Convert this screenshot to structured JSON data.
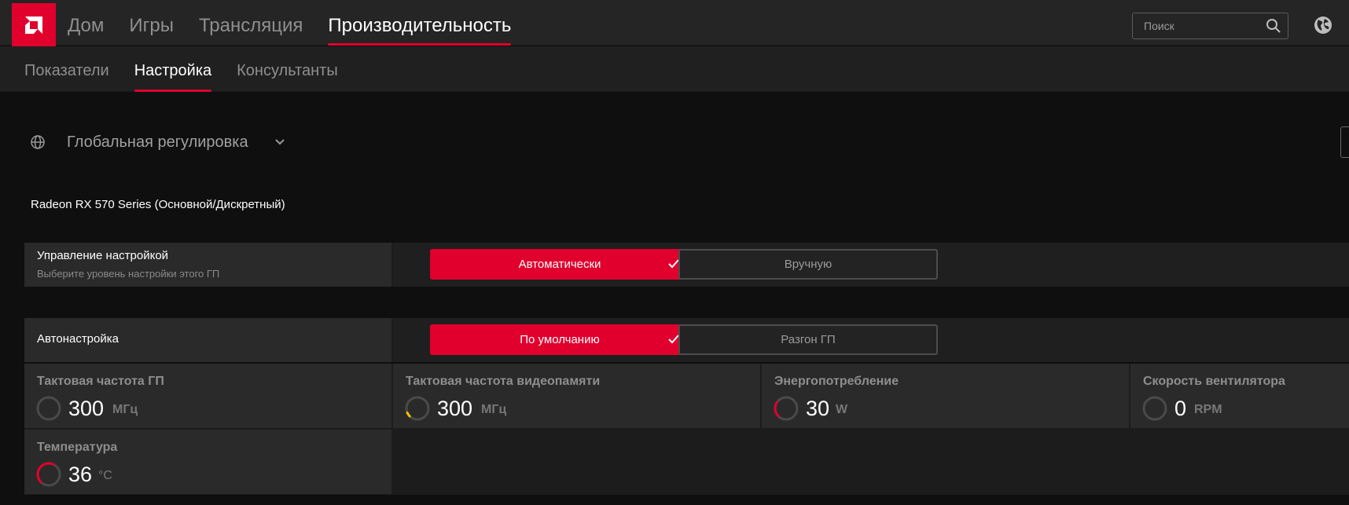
{
  "topnav": {
    "items": [
      "Дом",
      "Игры",
      "Трансляция",
      "Производительность"
    ],
    "active_index": 3
  },
  "search": {
    "placeholder": "Поиск"
  },
  "subnav": {
    "items": [
      "Показатели",
      "Настройка",
      "Консультанты"
    ],
    "active_index": 1
  },
  "profile": {
    "label": "Глобальная регулировка"
  },
  "gpu_name": "Radeon RX 570 Series (Основной/Дискретный)",
  "tuning_control": {
    "title": "Управление настройкой",
    "subtitle": "Выберите уровень настройки этого ГП",
    "options": [
      "Автоматически",
      "Вручную"
    ],
    "selected_index": 0
  },
  "auto_tuning": {
    "title": "Автонастройка",
    "options": [
      "По умолчанию",
      "Разгон ГП"
    ],
    "selected_index": 0
  },
  "metrics": [
    {
      "title": "Тактовая частота ГП",
      "value": "300",
      "unit": "МГц",
      "gauge_fraction": 0.0,
      "gauge_color": "#e1002d"
    },
    {
      "title": "Тактовая частота видеопамяти",
      "value": "300",
      "unit": "МГц",
      "gauge_fraction": 0.06,
      "gauge_color": "#f5c400"
    },
    {
      "title": "Энергопотребление",
      "value": "30",
      "unit": "W",
      "gauge_fraction": 0.22,
      "gauge_color": "#e1002d"
    },
    {
      "title": "Скорость вентилятора",
      "value": "0",
      "unit": "RPM",
      "gauge_fraction": 0.0,
      "gauge_color": "#e1002d"
    },
    {
      "title": "Температура",
      "value": "36",
      "unit": "°C",
      "gauge_fraction": 0.45,
      "gauge_color": "#e1002d"
    }
  ],
  "colors": {
    "accent": "#e1002d",
    "panel": "#2a2a2a",
    "background": "#0f0f0f"
  }
}
